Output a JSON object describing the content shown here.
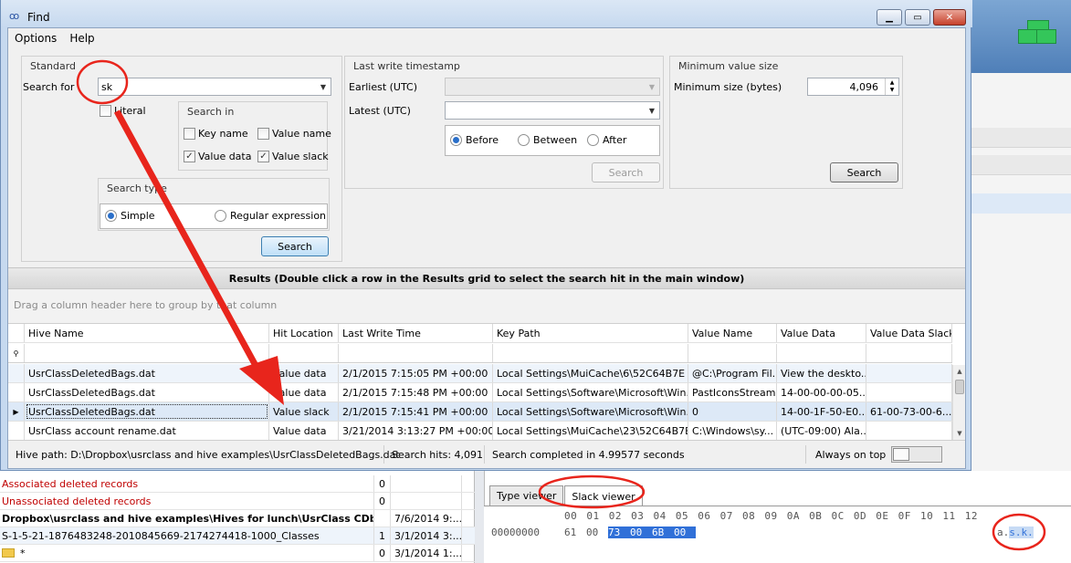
{
  "window": {
    "title": "Find"
  },
  "menu": [
    "Options",
    "Help"
  ],
  "standard": {
    "title": "Standard",
    "search_for_label": "Search for",
    "search_value": "sk",
    "literal_label": "Literal",
    "search_in_title": "Search in",
    "key_name": "Key name",
    "value_name": "Value name",
    "value_data": "Value data",
    "value_slack": "Value slack",
    "search_type_title": "Search type",
    "simple": "Simple",
    "regex": "Regular expression",
    "search_button": "Search"
  },
  "timestamp": {
    "title": "Last write timestamp",
    "earliest_label": "Earliest (UTC)",
    "latest_label": "Latest (UTC)",
    "before": "Before",
    "between": "Between",
    "after": "After",
    "search_button": "Search"
  },
  "minsize": {
    "title": "Minimum value size",
    "label": "Minimum size (bytes)",
    "value": "4,096",
    "search_button": "Search"
  },
  "results": {
    "banner": "Results (Double click a row in the Results grid to select the search hit in the main window)",
    "group_hint": "Drag a column header here to group by that column",
    "columns": [
      "Hive Name",
      "Hit Location",
      "Last Write Time",
      "Key Path",
      "Value Name",
      "Value Data",
      "Value Data Slack"
    ],
    "rows": [
      [
        "UsrClassDeletedBags.dat",
        "Value data",
        "2/1/2015 7:15:05 PM +00:00",
        "Local Settings\\MuiCache\\6\\52C64B7E",
        "@C:\\Program Fil...",
        "View the deskto...",
        ""
      ],
      [
        "UsrClassDeletedBags.dat",
        "Value data",
        "2/1/2015 7:15:48 PM +00:00",
        "Local Settings\\Software\\Microsoft\\Win...",
        "PastIconsStream",
        "14-00-00-00-05...",
        ""
      ],
      [
        "UsrClassDeletedBags.dat",
        "Value slack",
        "2/1/2015 7:15:41 PM +00:00",
        "Local Settings\\Software\\Microsoft\\Win...",
        "0",
        "14-00-1F-50-E0...",
        "61-00-73-00-6..."
      ],
      [
        "UsrClass account rename.dat",
        "Value data",
        "3/21/2014 3:13:27 PM +00:00",
        "Local Settings\\MuiCache\\23\\52C64B7E",
        "C:\\Windows\\sy...",
        "(UTC-09:00) Ala...",
        ""
      ]
    ]
  },
  "status": {
    "hive_path": "Hive path: D:\\Dropbox\\usrclass and hive examples\\UsrClassDeletedBags.dat",
    "hits": "Search hits: 4,091",
    "completed": "Search completed in 4.99577 seconds",
    "always_on_top": "Always on top"
  },
  "bg_tree": [
    {
      "name": "Associated deleted records",
      "count": "0",
      "date": "",
      "style": "red"
    },
    {
      "name": "Unassociated deleted records",
      "count": "0",
      "date": "",
      "style": "red"
    },
    {
      "name": "Dropbox\\usrclass and hive examples\\Hives for lunch\\UsrClass CDbur...",
      "count": "",
      "date": "7/6/2014 9:...",
      "style": "bold"
    },
    {
      "name": "S-1-5-21-1876483248-2010845669-2174274418-1000_Classes",
      "count": "1",
      "date": "3/1/2014 3:...",
      "style": ""
    },
    {
      "name": "*",
      "count": "0",
      "date": "3/1/2014 1:...",
      "style": ""
    }
  ],
  "viewer": {
    "tabs": [
      "Type viewer",
      "Slack viewer"
    ],
    "hex_header": [
      "00",
      "01",
      "02",
      "03",
      "04",
      "05",
      "06",
      "07",
      "08",
      "09",
      "0A",
      "0B",
      "0C",
      "0D",
      "0E",
      "0F",
      "10",
      "11",
      "12"
    ],
    "offset": "00000000",
    "bytes": [
      "61",
      "00",
      "73",
      "00",
      "6B",
      "00"
    ],
    "ascii_plain": "a.",
    "ascii_selected": "s.k."
  },
  "colors": {
    "annotation": "#e8251c",
    "accent": "#3070d8",
    "deleted": "#c00000"
  }
}
